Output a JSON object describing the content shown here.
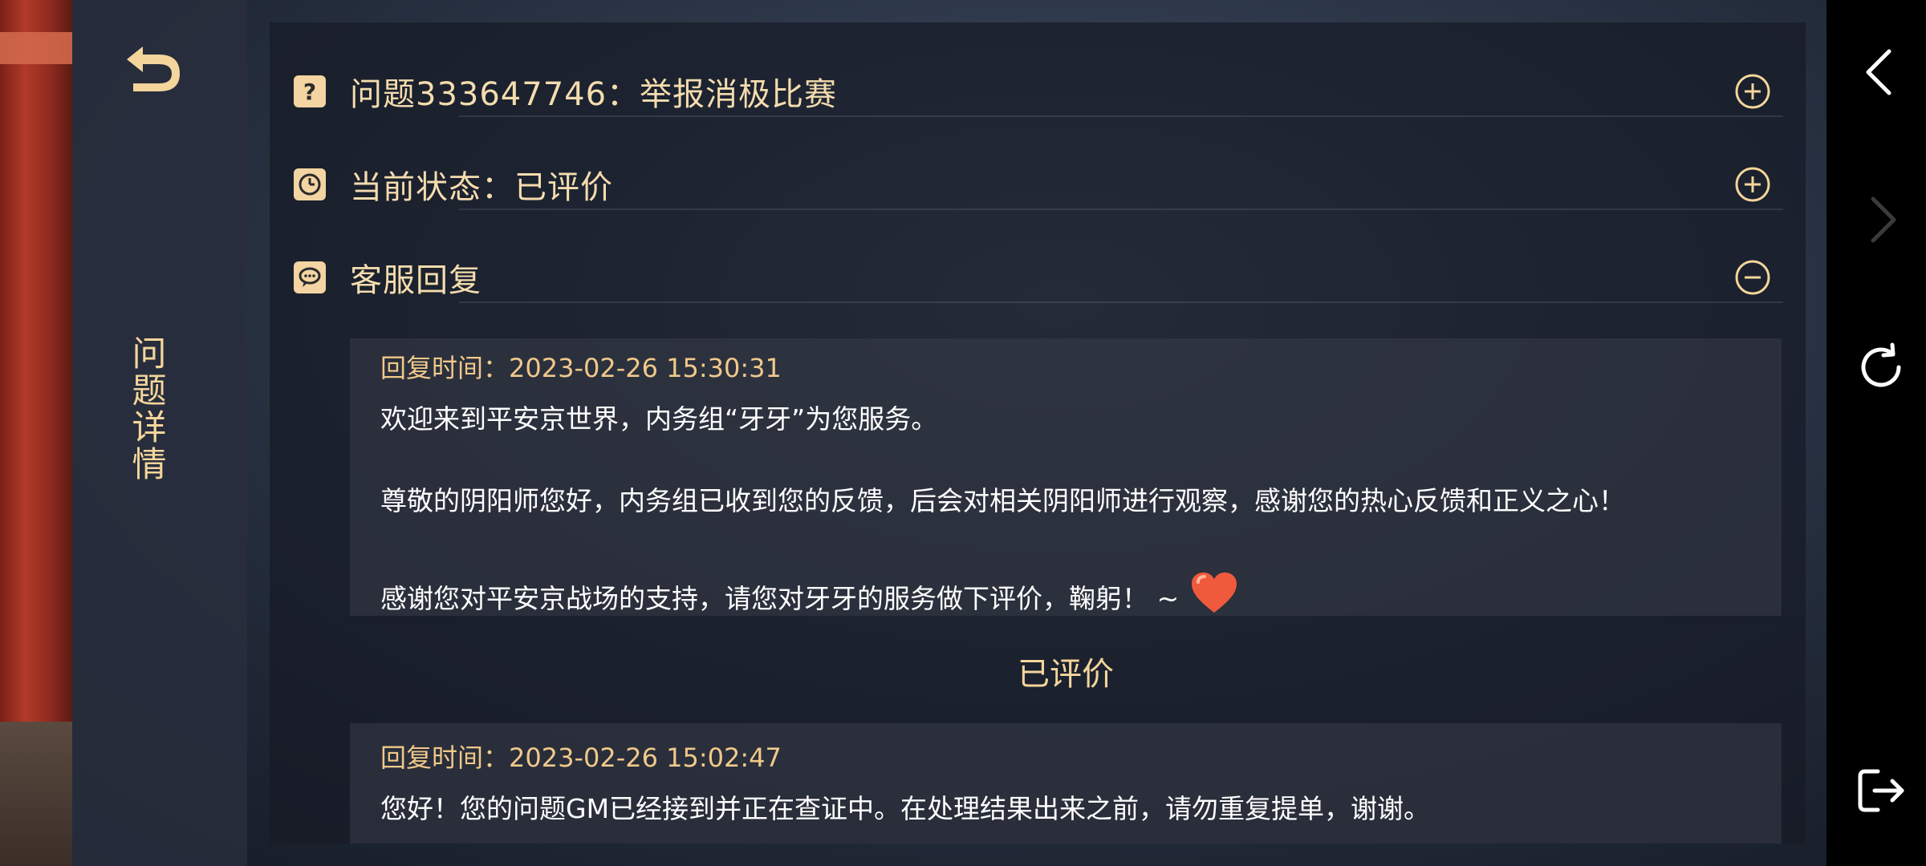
{
  "sidebar": {
    "title": "问题详情"
  },
  "question": {
    "title": "问题333647746：举报消极比赛",
    "status": "当前状态：已评价",
    "reply_section": "客服回复"
  },
  "replies": [
    {
      "time": "回复时间：2023-02-26 15:30:31",
      "lines": [
        "欢迎来到平安京世界，内务组“牙牙”为您服务。",
        "尊敬的阴阳师您好，内务组已收到您的反馈，后会对相关阴阳师进行观察，感谢您的热心反馈和正义之心！",
        "感谢您对平安京战场的支持，请您对牙牙的服务做下评价，鞠躬！ ~"
      ]
    },
    {
      "time": "回复时间：2023-02-26 15:02:47",
      "lines": [
        "您好！您的问题GM已经接到并正在查证中。在处理结果出来之前，请勿重复提单，谢谢。"
      ]
    }
  ],
  "rated_label": "已评价",
  "icons": {
    "back": "back-arrow-icon",
    "question": "question-icon",
    "clock": "clock-icon",
    "chat": "chat-bubble-icon",
    "expand": "plus-circle-icon",
    "collapse": "minus-circle-icon",
    "heart": "heart-icon"
  },
  "colors": {
    "accent": "#f4d59b",
    "time": "#f0c98a",
    "text": "#ffffff"
  }
}
